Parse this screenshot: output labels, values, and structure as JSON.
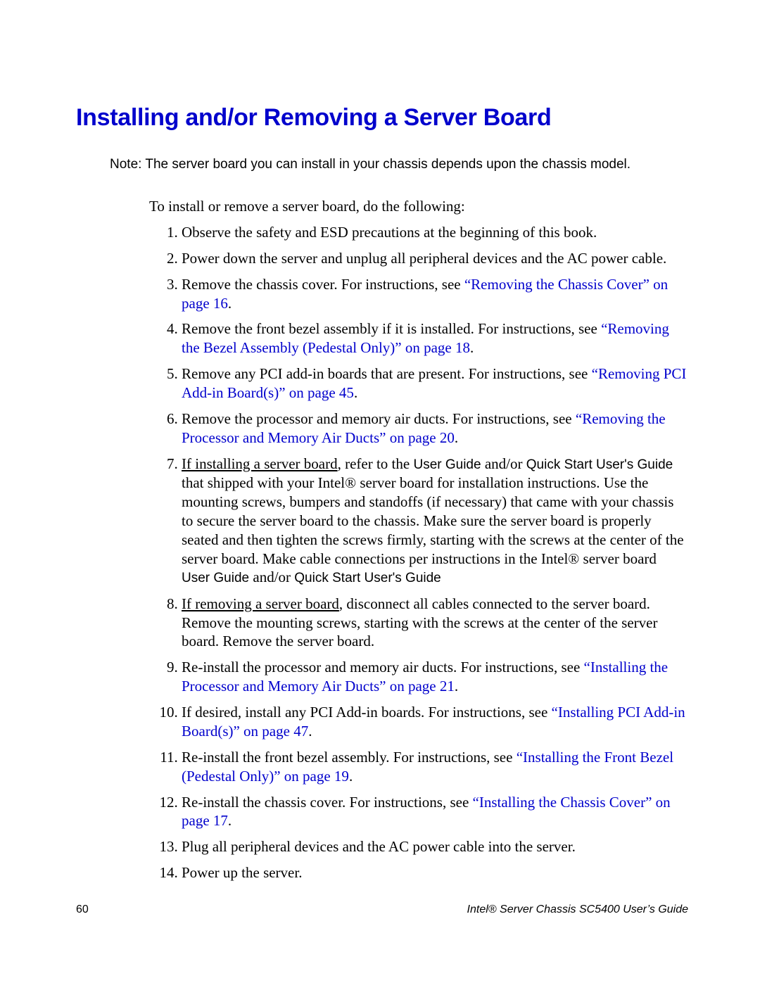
{
  "title": "Installing and/or Removing a Server Board",
  "note_prefix": "Note:",
  "note": " The server board you can install in your chassis depends upon the chassis model.",
  "intro": "To install or remove a server board, do the following:",
  "steps": {
    "s1": "Observe the safety and ESD precautions at the beginning of this book.",
    "s2": "Power down the server and unplug all peripheral devices and the AC power cable.",
    "s3a": "Remove the chassis cover. For instructions, see ",
    "s3link": "“Removing the Chassis Cover” on page 16",
    "s3b": ".",
    "s4a": "Remove the front bezel assembly if it is installed. For instructions, see ",
    "s4link": "“Removing the Bezel Assembly (Pedestal Only)” on page 18",
    "s4b": ".",
    "s5a": "Remove any PCI add-in boards that are present. For instructions, see ",
    "s5link": "“Removing PCI Add-in Board(s)” on page 45",
    "s5b": ".",
    "s6a": "Remove the processor and memory air ducts. For instructions, see ",
    "s6link": "“Removing the Processor and Memory Air Ducts” on page 20",
    "s6b": ".",
    "s7u": "If installing a server board",
    "s7a": ", refer to the ",
    "s7sans1": "User Guide ",
    "s7b": "and/or ",
    "s7sans2": "Quick Start User's Guide",
    "s7c": " that shipped with your Intel® server board for installation instructions. Use the mounting screws, bumpers and standoffs (if necessary) that came with your chassis to secure the server board to the chassis. Make sure the server board is properly seated and then tighten the screws firmly, starting with the screws at the center of the server board. Make cable connections per instructions in the Intel® server board ",
    "s7sans3": "User Guide ",
    "s7d": "and/or ",
    "s7sans4": "Quick Start User's Guide",
    "s8u": "If removing a server board",
    "s8a": ", disconnect all cables connected to the server board. Remove the mounting screws, starting with the screws at the center of the server board. Remove the server board.",
    "s9a": "Re-install the processor and memory air ducts. For instructions, see ",
    "s9link": "“Installing the Processor and Memory Air Ducts” on page 21",
    "s9b": ".",
    "s10a": "If desired, install any PCI Add-in boards. For instructions, see ",
    "s10link": "“Installing PCI Add-in Board(s)” on page 47",
    "s10b": ".",
    "s11a": "Re-install the front bezel assembly. For instructions, see ",
    "s11link": "“Installing the Front Bezel (Pedestal Only)” on page 19",
    "s11b": ".",
    "s12a": "Re-install the chassis cover. For instructions, see ",
    "s12link": "“Installing the Chassis Cover” on page 17",
    "s12b": ".",
    "s13": "Plug all peripheral devices and the AC power cable into the server.",
    "s14": "Power up the server."
  },
  "footer": {
    "page_number": "60",
    "doc_title": "Intel® Server Chassis SC5400 User’s Guide"
  }
}
